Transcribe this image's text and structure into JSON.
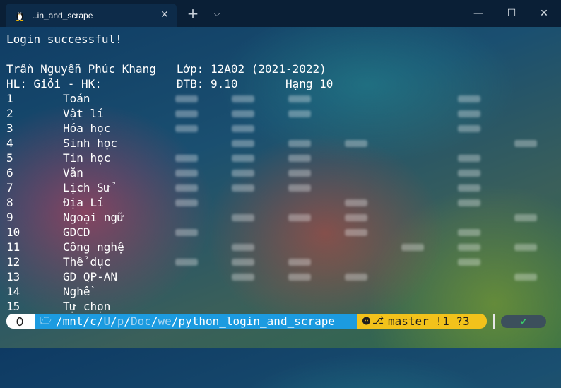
{
  "window": {
    "tab_title": "..in_and_scrape",
    "tab_close_glyph": "✕",
    "new_tab_glyph": "+",
    "dropdown_glyph": "⌵",
    "minimize_glyph": "—",
    "maximize_glyph": "☐",
    "close_glyph": "✕"
  },
  "terminal": {
    "login_message": "Login successful!",
    "student_line": "Trần Nguyễn Phúc Khang   Lớp: 12A02 (2021-2022)",
    "summary_line": "HL: Giỏi - HK:           ĐTB: 9.10       Hạng 10",
    "subjects": [
      {
        "num": "1",
        "name": "Toán"
      },
      {
        "num": "2",
        "name": "Vật lí"
      },
      {
        "num": "3",
        "name": "Hóa học"
      },
      {
        "num": "4",
        "name": "Sinh học"
      },
      {
        "num": "5",
        "name": "Tin học"
      },
      {
        "num": "6",
        "name": "Văn"
      },
      {
        "num": "7",
        "name": "Lịch Sử"
      },
      {
        "num": "8",
        "name": "Địa Lí"
      },
      {
        "num": "9",
        "name": "Ngoại ngữ"
      },
      {
        "num": "10",
        "name": "GDCD"
      },
      {
        "num": "11",
        "name": "Công nghệ"
      },
      {
        "num": "12",
        "name": "Thể dục"
      },
      {
        "num": "13",
        "name": "GD QP-AN"
      },
      {
        "num": "14",
        "name": "Nghề"
      },
      {
        "num": "15",
        "name": "Tự chọn"
      }
    ]
  },
  "prompt": {
    "folder_glyph": "🗁",
    "path_parts": [
      "/mnt/c/",
      "U",
      "/",
      "p",
      "/",
      "Doc",
      "/",
      "we",
      "/python_login_and_scrape"
    ],
    "branch_glyph": "⎇",
    "git_status": "master !1 ?3",
    "status_ok_glyph": "✔",
    "colors": {
      "os_segment": "#ffffff",
      "path_segment": "#1c9be0",
      "git_segment": "#f2c21b",
      "ok": "#3ad16a"
    }
  }
}
